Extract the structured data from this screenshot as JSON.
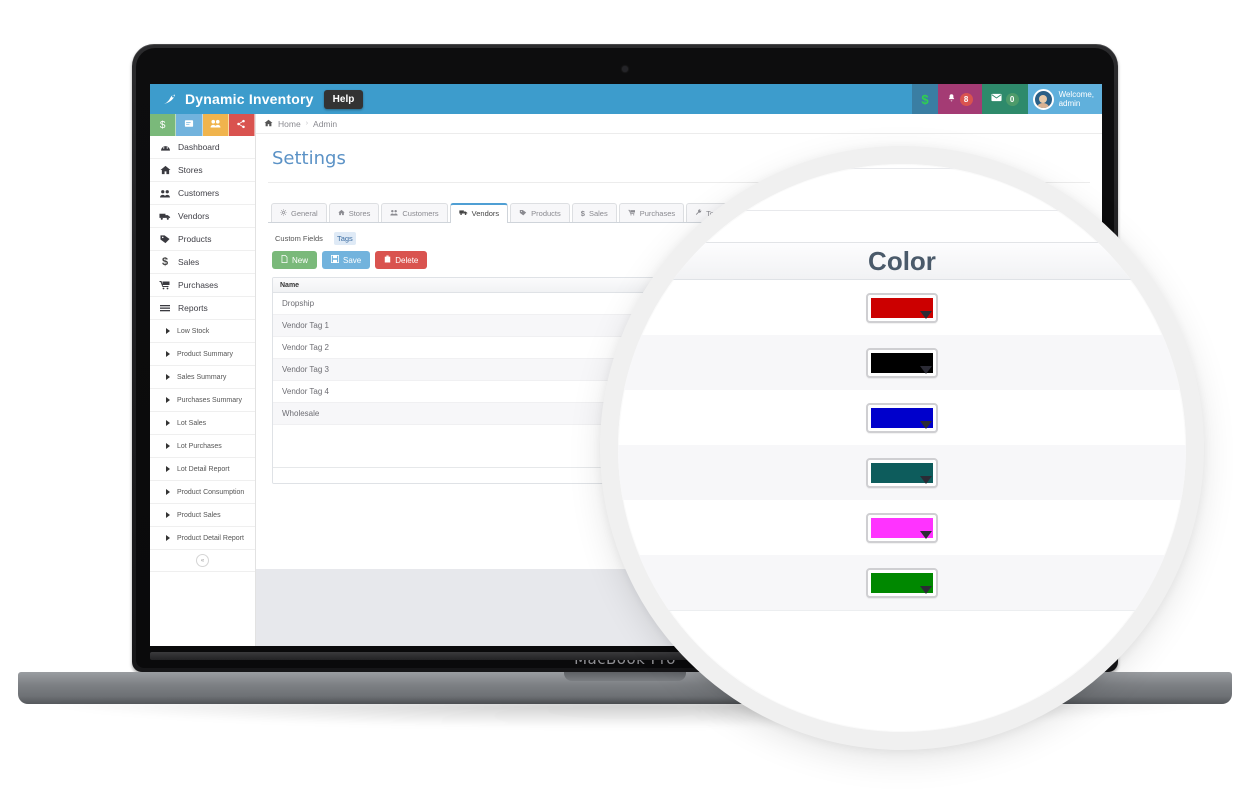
{
  "device": {
    "label": "MacBook Pro"
  },
  "app": {
    "brand": "Dynamic Inventory",
    "help_label": "Help",
    "topbar_right": {
      "money_icon": "dollar-icon",
      "money_symbol": "$",
      "bell_icon": "bell-icon",
      "bell_badge": "8",
      "mail_icon": "envelope-icon",
      "mail_badge": "0",
      "welcome_line1": "Welcome,",
      "welcome_line2": "admin"
    }
  },
  "quick_actions": [
    {
      "name": "quick-sales",
      "icon": "dollar-icon",
      "glyph": "$",
      "color": "#7ab97a"
    },
    {
      "name": "quick-reports",
      "icon": "document-icon",
      "glyph": "☰",
      "color": "#72b3dd"
    },
    {
      "name": "quick-customers",
      "icon": "people-icon",
      "glyph": "♟",
      "color": "#f0b44d"
    },
    {
      "name": "quick-settings",
      "icon": "share-icon",
      "glyph": "⚭",
      "color": "#d9534f"
    }
  ],
  "sidebar": {
    "items": [
      {
        "label": "Dashboard",
        "icon": "dashboard-icon",
        "glyph": "◔"
      },
      {
        "label": "Stores",
        "icon": "home-icon",
        "glyph": "⌂"
      },
      {
        "label": "Customers",
        "icon": "people-icon",
        "glyph": "♟"
      },
      {
        "label": "Vendors",
        "icon": "truck-icon",
        "glyph": "⛟"
      },
      {
        "label": "Products",
        "icon": "tag-icon",
        "glyph": "▰"
      },
      {
        "label": "Sales",
        "icon": "dollar-icon",
        "glyph": "$"
      },
      {
        "label": "Purchases",
        "icon": "cart-icon",
        "glyph": "⛟"
      },
      {
        "label": "Reports",
        "icon": "list-icon",
        "glyph": "☰"
      }
    ],
    "reports": [
      {
        "label": "Low Stock"
      },
      {
        "label": "Product Summary"
      },
      {
        "label": "Sales Summary"
      },
      {
        "label": "Purchases Summary"
      },
      {
        "label": "Lot Sales"
      },
      {
        "label": "Lot Purchases"
      },
      {
        "label": "Lot Detail Report"
      },
      {
        "label": "Product Consumption"
      },
      {
        "label": "Product Sales"
      },
      {
        "label": "Product Detail Report"
      }
    ],
    "collapse_label": "«"
  },
  "breadcrumb": {
    "home_icon": "home-icon",
    "items": [
      "Home",
      "Admin"
    ],
    "separator": "›"
  },
  "page": {
    "title": "Settings"
  },
  "tabs": [
    {
      "label": "General",
      "icon": "gear-icon",
      "glyph": "⚙",
      "active": false
    },
    {
      "label": "Stores",
      "icon": "home-icon",
      "glyph": "⌂",
      "active": false
    },
    {
      "label": "Customers",
      "icon": "people-icon",
      "glyph": "♟",
      "active": false
    },
    {
      "label": "Vendors",
      "icon": "truck-icon",
      "glyph": "⛟",
      "active": true
    },
    {
      "label": "Products",
      "icon": "tag-icon",
      "glyph": "▰",
      "active": false
    },
    {
      "label": "Sales",
      "icon": "dollar-icon",
      "glyph": "$",
      "active": false
    },
    {
      "label": "Purchases",
      "icon": "cart-icon",
      "glyph": "⛟",
      "active": false
    },
    {
      "label": "Tools",
      "icon": "wrench-icon",
      "glyph": "⚒",
      "active": false
    }
  ],
  "subtabs": [
    {
      "label": "Custom Fields",
      "selected": false
    },
    {
      "label": "Tags",
      "selected": true
    }
  ],
  "toolbar": {
    "new_label": "New",
    "new_icon": "file-icon",
    "save_label": "Save",
    "save_icon": "floppy-icon",
    "delete_label": "Delete",
    "delete_icon": "trash-icon"
  },
  "grid": {
    "columns": [
      "Name",
      "Color"
    ],
    "rows": [
      {
        "name": "Dropship",
        "color": "#CC0000"
      },
      {
        "name": "Vendor Tag 1",
        "color": "#000000"
      },
      {
        "name": "Vendor Tag 2",
        "color": "#0000CC"
      },
      {
        "name": "Vendor Tag 3",
        "color": "#0D5C5C"
      },
      {
        "name": "Vendor Tag 4",
        "color": "#FF33FF"
      },
      {
        "name": "Wholesale",
        "color": "#008800"
      }
    ]
  },
  "magnifier": {
    "column_title": "Color",
    "swatches": [
      "#CC0000",
      "#000000",
      "#0000CC",
      "#0D5C5C",
      "#FF33FF",
      "#008800"
    ]
  },
  "theme": {
    "topbar": "#3d9ccc",
    "accent": "#5b92c6",
    "green": "#7ab97a",
    "blue": "#72b3dd",
    "red": "#d9534f",
    "orange": "#f0b44d"
  }
}
